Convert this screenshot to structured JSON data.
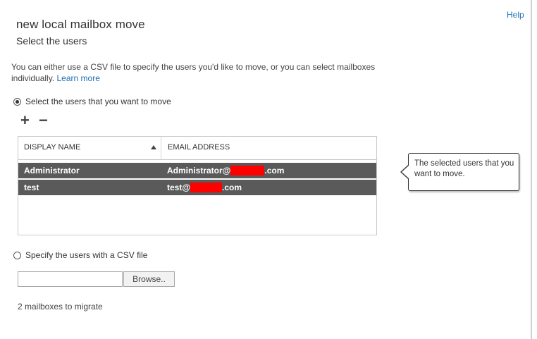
{
  "header": {
    "help_label": "Help",
    "title": "new local mailbox move",
    "subtitle": "Select the users"
  },
  "description": {
    "text": "You can either use a CSV file to specify the users you'd like to move, or you can select mailboxes individually.",
    "link": "Learn more"
  },
  "option_select": {
    "label": "Select the users that you want to move",
    "checked": true
  },
  "toolbar": {
    "add_icon": "+",
    "remove_icon": "−"
  },
  "grid": {
    "columns": [
      "DISPLAY NAME",
      "EMAIL ADDRESS"
    ],
    "sort": "ascending",
    "rows": [
      {
        "display_name": "Administrator",
        "email_prefix": "Administrator@",
        "email_suffix": ".com"
      },
      {
        "display_name": "test",
        "email_prefix": "test@",
        "email_suffix": ".com"
      }
    ]
  },
  "callout": {
    "text": "The selected users that you want to move."
  },
  "option_csv": {
    "label": "Specify the users with a CSV file",
    "checked": false
  },
  "csv": {
    "value": "",
    "browse_label": "Browse.."
  },
  "status": {
    "count_text": "2 mailboxes to migrate"
  },
  "colors": {
    "link": "#1e6fb8",
    "selected_row": "#5a5a5a",
    "redaction": "#ff0000"
  }
}
